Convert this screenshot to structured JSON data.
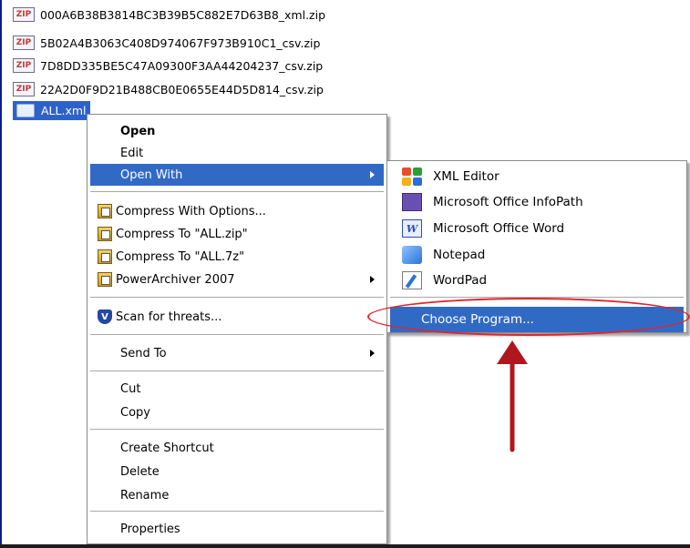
{
  "files": [
    {
      "icon": "ZIP",
      "name": "000A6B38B3814BC3B39B5C882E7D63B8_xml.zip"
    },
    {
      "icon": "ZIP",
      "name": "5B02A4B3063C408D974067F973B910C1_csv.zip"
    },
    {
      "icon": "ZIP",
      "name": "7D8DD335BE5C47A09300F3AA44204237_csv.zip"
    },
    {
      "icon": "ZIP",
      "name": "22A2D0F9D21B488CB0E0655E44D5D814_csv.zip"
    }
  ],
  "selected_file": {
    "name": "ALL.xml"
  },
  "context_menu": {
    "open": "Open",
    "edit": "Edit",
    "open_with": "Open With",
    "compress_with_options": "Compress With Options...",
    "compress_to_zip": "Compress To \"ALL.zip\"",
    "compress_to_7z": "Compress To \"ALL.7z\"",
    "powerarchiver": "PowerArchiver 2007",
    "scan": "Scan for threats...",
    "send_to": "Send To",
    "cut": "Cut",
    "copy": "Copy",
    "create_shortcut": "Create Shortcut",
    "delete": "Delete",
    "rename": "Rename",
    "properties": "Properties"
  },
  "open_with_menu": {
    "xml_editor": "XML Editor",
    "infopath": "Microsoft Office InfoPath",
    "word": "Microsoft Office Word",
    "notepad": "Notepad",
    "wordpad": "WordPad",
    "choose_program": "Choose Program..."
  },
  "icons": {
    "word_glyph": "W",
    "shield_glyph": "V"
  },
  "colors": {
    "highlight": "#316ac5",
    "annotation": "#e0262c",
    "arrow": "#b0161e"
  }
}
